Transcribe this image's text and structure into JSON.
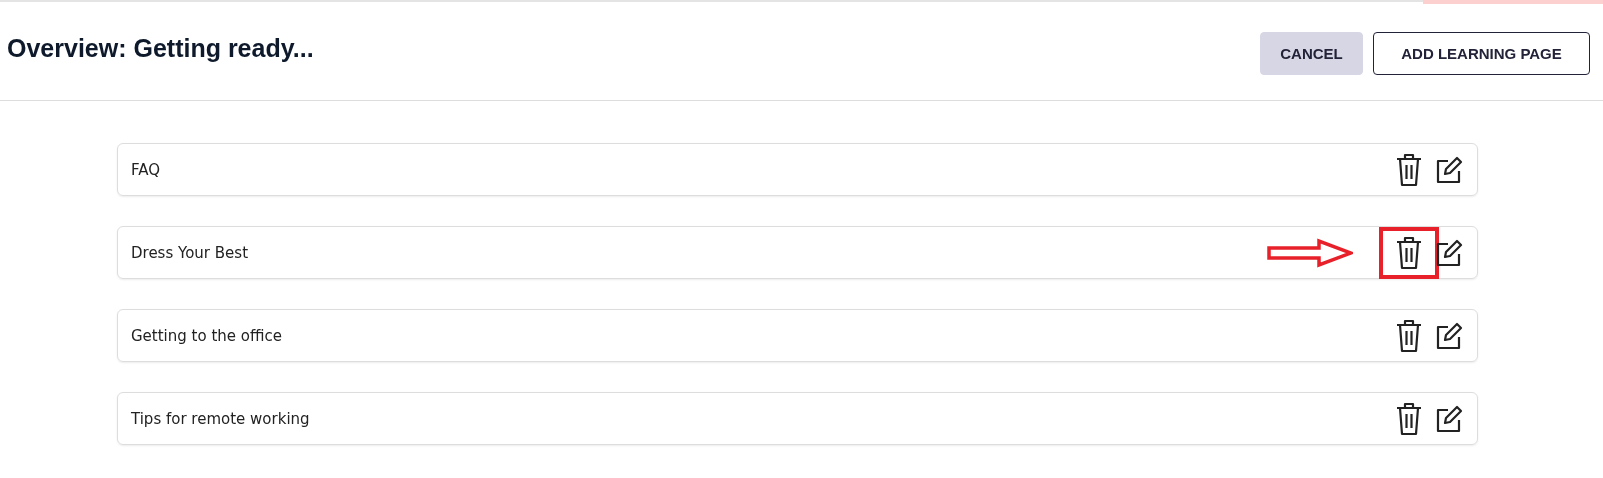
{
  "header": {
    "title": "Overview: Getting ready...",
    "buttons": [
      {
        "label": "CANCEL",
        "kind": "secondary"
      },
      {
        "label": "ADD LEARNING PAGE",
        "kind": "outline"
      }
    ]
  },
  "pages": [
    {
      "title": "FAQ",
      "delete_highlighted": false
    },
    {
      "title": "Dress Your Best",
      "delete_highlighted": true
    },
    {
      "title": "Getting to the office",
      "delete_highlighted": false
    },
    {
      "title": "Tips for remote working",
      "delete_highlighted": false
    }
  ]
}
